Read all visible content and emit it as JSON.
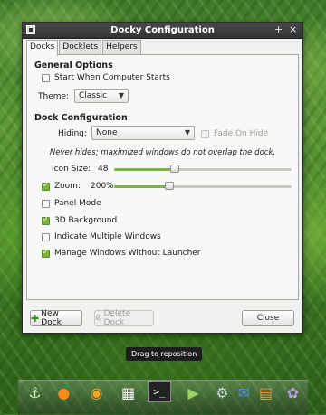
{
  "window": {
    "title": "Docky Configuration",
    "pin_glyph": "+",
    "close_glyph": "×"
  },
  "tabs": [
    "Docks",
    "Docklets",
    "Helpers"
  ],
  "general": {
    "heading": "General Options",
    "start_checkbox": {
      "label": "Start When Computer Starts",
      "checked": false
    },
    "theme_label": "Theme:",
    "theme_value": "Classic"
  },
  "dock_config": {
    "heading": "Dock Configuration",
    "hiding_label": "Hiding:",
    "hiding_value": "None",
    "fade_label": "Fade On Hide",
    "hint": "Never hides; maximized windows do not overlap the dock.",
    "icon_size_label": "Icon Size:",
    "icon_size_value": "48",
    "icon_size_level": 0.34,
    "zoom_label": "Zoom:",
    "zoom_value": "200%",
    "zoom_level": 0.31,
    "zoom_checked": true,
    "panel_mode": {
      "label": "Panel Mode",
      "checked": false
    },
    "background_3d": {
      "label": "3D Background",
      "checked": true
    },
    "indicate_multiple": {
      "label": "Indicate Multiple Windows",
      "checked": false
    },
    "manage_windows": {
      "label": "Manage Windows Without Launcher",
      "checked": true
    }
  },
  "buttons": {
    "new_dock": "New Dock",
    "delete_dock": "Delete Dock",
    "close": "Close"
  },
  "tooltip": "Drag to reposition",
  "dock_icons": [
    "anchor-icon",
    "firefox-icon",
    "sound-juicer-icon",
    "calendar-icon",
    "terminal-icon",
    "media-player-icon",
    "system-settings-icon",
    "chat-icon",
    "folder-icon",
    "pidgin-icon"
  ]
}
